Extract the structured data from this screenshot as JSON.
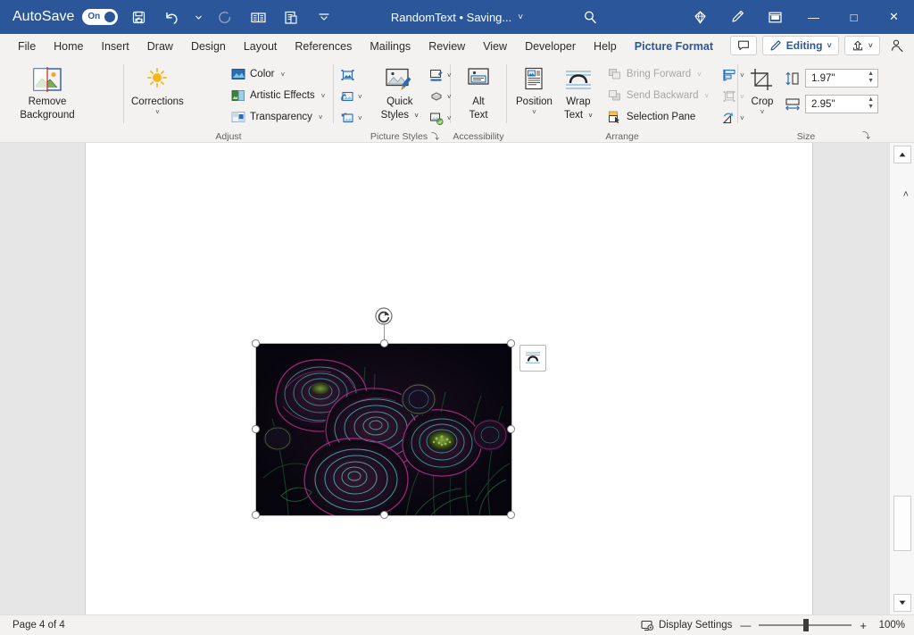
{
  "titlebar": {
    "autosave_label": "AutoSave",
    "autosave_state": "On",
    "document_title": "RandomText • Saving...",
    "title_chevron": "˅",
    "quick_access": [
      {
        "name": "save-icon",
        "label": "Save"
      },
      {
        "name": "undo-icon",
        "label": "Undo"
      },
      {
        "name": "undo-dropdown-icon",
        "label": "Undo options"
      },
      {
        "name": "redo-icon",
        "label": "Redo",
        "disabled": true
      },
      {
        "name": "read-aloud-icon",
        "label": "Read Aloud"
      },
      {
        "name": "copy-format-icon",
        "label": "Copy Format"
      },
      {
        "name": "customize-qat-icon",
        "label": "Customize Quick Access Toolbar"
      }
    ],
    "search_icon": "search-icon",
    "right_icons": [
      {
        "name": "diamond-icon",
        "label": "Microsoft 365"
      },
      {
        "name": "pen-highlight-icon",
        "label": "Draw"
      },
      {
        "name": "ribbon-display-icon",
        "label": "Ribbon Display Options"
      }
    ],
    "window_buttons": {
      "minimize": "—",
      "maximize": "□",
      "close": "✕"
    }
  },
  "tabs": {
    "items": [
      {
        "label": "File",
        "active": false
      },
      {
        "label": "Home",
        "active": false
      },
      {
        "label": "Insert",
        "active": false
      },
      {
        "label": "Draw",
        "active": false
      },
      {
        "label": "Design",
        "active": false
      },
      {
        "label": "Layout",
        "active": false
      },
      {
        "label": "References",
        "active": false
      },
      {
        "label": "Mailings",
        "active": false
      },
      {
        "label": "Review",
        "active": false
      },
      {
        "label": "View",
        "active": false
      },
      {
        "label": "Developer",
        "active": false
      },
      {
        "label": "Help",
        "active": false
      },
      {
        "label": "Picture Format",
        "active": true
      }
    ],
    "right": {
      "comments_label": "",
      "editing_label": "Editing",
      "editing_chevron": "˅",
      "share_chevron": "˅"
    }
  },
  "ribbon": {
    "collapse_chevron": "˄",
    "groups": [
      {
        "name": "adjust",
        "label": "Adjust",
        "remove_background": {
          "line1": "Remove",
          "line2": "Background"
        },
        "corrections": {
          "label": "Corrections",
          "chevron": "˅"
        },
        "items": [
          {
            "label": "Color",
            "chevron": "˅",
            "icon": "color-icon"
          },
          {
            "label": "Artistic Effects",
            "chevron": "˅",
            "icon": "artistic-effects-icon"
          },
          {
            "label": "Transparency",
            "chevron": "˅",
            "icon": "transparency-icon"
          }
        ]
      },
      {
        "name": "picture-styles",
        "label": "Picture Styles",
        "quick_styles": {
          "line1": "Quick",
          "line2": "Styles",
          "chevron": "˅"
        },
        "icons": [
          {
            "name": "picture-border-icon",
            "chevron": "˅"
          },
          {
            "name": "picture-effects-icon",
            "chevron": "˅"
          },
          {
            "name": "picture-layout-icon",
            "chevron": "˅"
          }
        ],
        "left_icons": [
          {
            "name": "picture-frame-icon"
          },
          {
            "name": "reset-picture-icon",
            "chevron": "˅"
          },
          {
            "name": "change-picture-icon",
            "chevron": "˅"
          }
        ]
      },
      {
        "name": "accessibility",
        "label": "Accessibility",
        "alt_text": {
          "line1": "Alt",
          "line2": "Text"
        },
        "launcher": "⤵"
      },
      {
        "name": "arrange",
        "label": "Arrange",
        "position": {
          "label": "Position",
          "chevron": "˅"
        },
        "wrap_text": {
          "line1": "Wrap",
          "line2": "Text",
          "chevron": "˅"
        },
        "items": [
          {
            "label": "Bring Forward",
            "chevron": "˅",
            "icon": "bring-forward-icon",
            "disabled": true
          },
          {
            "label": "Send Backward",
            "chevron": "˅",
            "icon": "send-backward-icon",
            "disabled": true
          },
          {
            "label": "Selection Pane",
            "chevron": "",
            "icon": "selection-pane-icon",
            "disabled": false
          }
        ],
        "right_icons": [
          {
            "name": "align-objects-icon",
            "chevron": "˅",
            "disabled": false
          },
          {
            "name": "group-objects-icon",
            "chevron": "˅",
            "disabled": true
          },
          {
            "name": "rotate-objects-icon",
            "chevron": "˅",
            "disabled": false
          }
        ]
      },
      {
        "name": "size",
        "label": "Size",
        "crop": {
          "label": "Crop",
          "chevron": "˅"
        },
        "height": {
          "value": "1.97\"",
          "icon": "shape-height-icon"
        },
        "width": {
          "value": "2.95\"",
          "icon": "shape-width-icon"
        },
        "launcher": "⤵"
      }
    ]
  },
  "document": {
    "page_number": "Page 4 of 4",
    "picture": {
      "name": "ranunculus-flowers-glowing-edges",
      "alt": "Dark photo of ranunculus flowers with glowing edges artistic effect",
      "selected": true,
      "width_in": "2.95\"",
      "height_in": "1.97\""
    },
    "layout_options_icon": "layout-options-icon",
    "rotate_handle_icon": "rotate-handle-icon"
  },
  "statusbar": {
    "page_label": "Page 4 of 4",
    "display_settings_label": "Display Settings",
    "zoom_out": "—",
    "zoom_in": "+",
    "zoom_level": "100%"
  },
  "colors": {
    "title_bar": "#2b579a",
    "ribbon_bg": "#f3f2f1",
    "accent": "#2b579a",
    "canvas": "#e6e6e6",
    "page": "#ffffff"
  }
}
